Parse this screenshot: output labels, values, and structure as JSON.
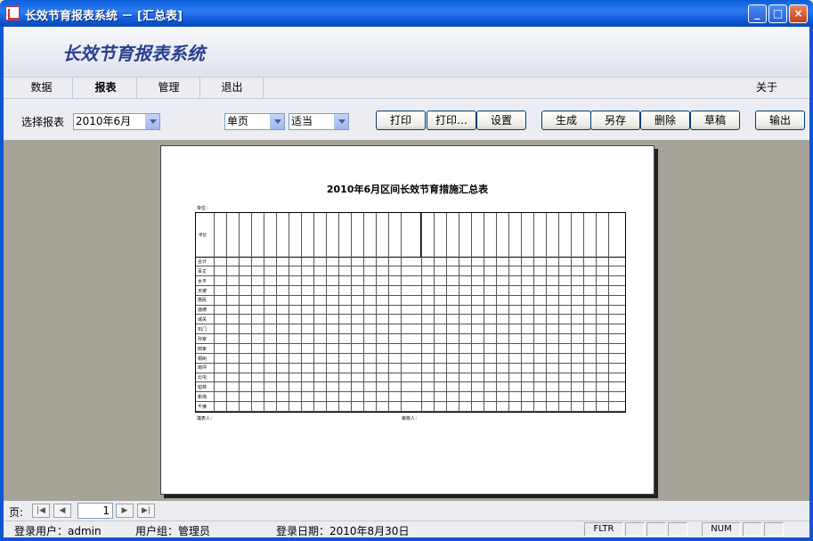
{
  "window": {
    "title": "长效节育报表系统 － [汇总表]"
  },
  "banner": {
    "app_title": "长效节育报表系统"
  },
  "menu": {
    "items": [
      "数据",
      "报表",
      "管理",
      "退出"
    ],
    "about": "关于"
  },
  "toolbar": {
    "report_label": "选择报表",
    "report_value": "2010年6月",
    "page_mode": "单页",
    "zoom": "适当",
    "print": "打印",
    "print_dialog": "打印…",
    "settings": "设置",
    "generate": "生成",
    "save_as": "另存",
    "delete": "删除",
    "draft": "草稿",
    "export": "输出"
  },
  "report": {
    "title": "2010年6月区间长效节育措施汇总表",
    "unit": "单位：",
    "row_label_header": "单位",
    "rows": [
      "合计",
      "百丈",
      "太平",
      "天坡",
      "惠民",
      "庙坡",
      "城关",
      "石门",
      "孙家",
      "田家",
      "桐树",
      "南坪",
      "北屯",
      "柏林",
      "新场",
      "千佛"
    ],
    "preparer": "填表人：",
    "reviewer": "审核人："
  },
  "pager": {
    "label": "页:",
    "page": "1"
  },
  "status": {
    "user": "登录用户：admin",
    "group": "用户组：管理员",
    "date": "登录日期：2010年8月30日",
    "fltr": "FLTR",
    "num": "NUM"
  }
}
